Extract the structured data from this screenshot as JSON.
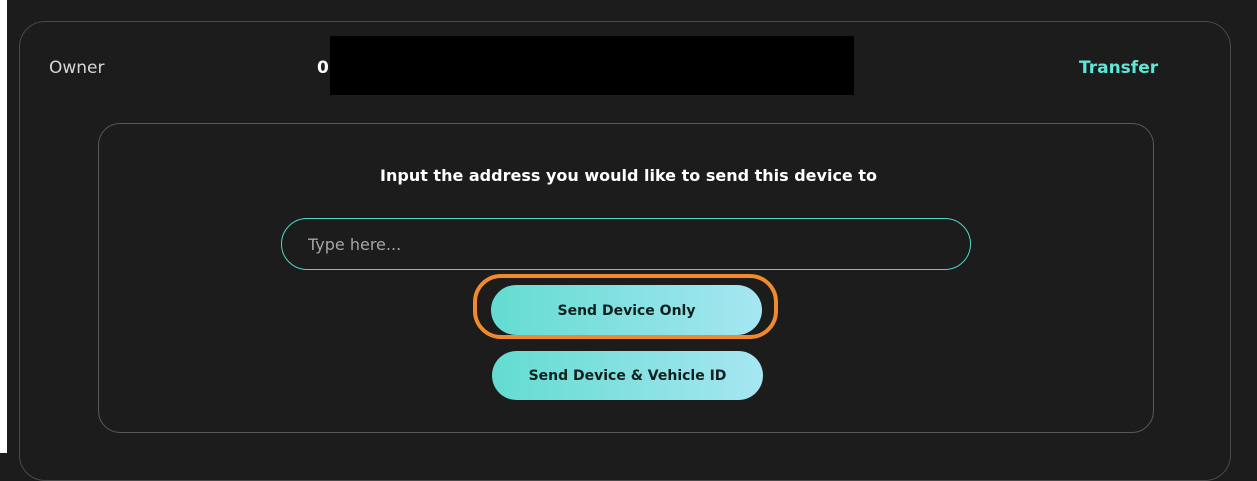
{
  "owner": {
    "label": "Owner",
    "address_visible": "0",
    "transfer_label": "Transfer"
  },
  "transfer_panel": {
    "prompt": "Input the address you would like to send this device to",
    "input": {
      "placeholder": "Type here...",
      "value": ""
    },
    "buttons": {
      "send_device_only": "Send Device Only",
      "send_device_and_vehicle": "Send Device & Vehicle ID"
    }
  },
  "colors": {
    "background": "#1c1c1c",
    "accent": "#5ee6d6",
    "highlight": "#f08a2c",
    "button_gradient_start": "#63dcd0",
    "button_gradient_end": "#a6e6f2"
  }
}
